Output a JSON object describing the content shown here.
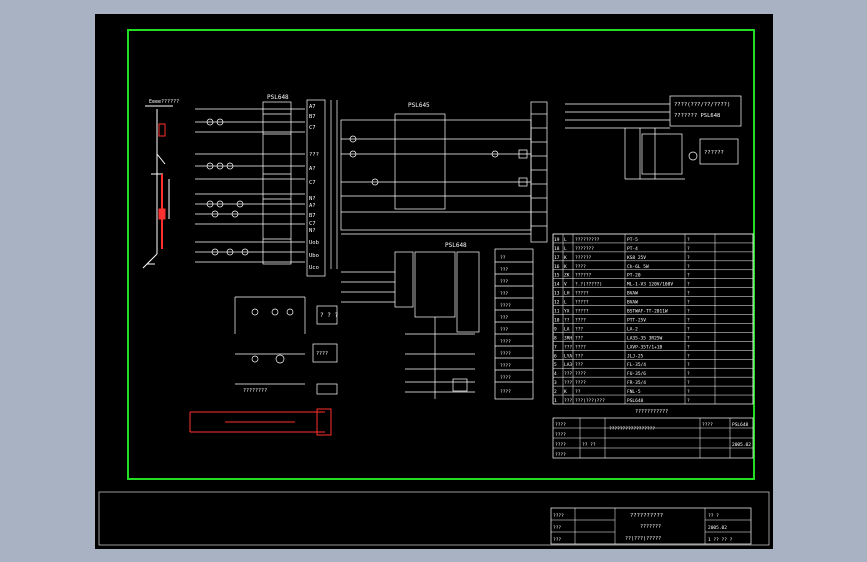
{
  "colors": {
    "background": "#a9b2c3",
    "sheet": "#000000",
    "frame": "#22dd22",
    "line": "#ffffff",
    "accent": "#ff3030"
  },
  "device_top": "PSL648",
  "device_mid": "PSL645",
  "device_lower": "PSL648",
  "top_right_box_1": "????(???/??/????)",
  "top_right_box_2": "??????? PSL648",
  "top_right_box_3": "??????",
  "left_terminals": [
    "A7",
    "B7",
    "C7",
    "???",
    "A?",
    "C7",
    "N?",
    "A?",
    "B7",
    "C7",
    "N?",
    "Uob",
    "Ubo",
    "Uco"
  ],
  "mid_box_label": "? ? ?",
  "mid_box_label2": "????",
  "meter_label": "????????",
  "lower_legend": [
    "??",
    "???",
    "???",
    "???",
    "????",
    "???",
    "???",
    "????",
    "????",
    "????",
    "????",
    "????"
  ],
  "bom_title": "???????????",
  "bom_rows": [
    {
      "no": "19",
      "sym": "L",
      "name": "?????????",
      "spec": "PT-5",
      "qty": "?"
    },
    {
      "no": "18",
      "sym": "L",
      "name": "???????",
      "spec": "PT-4",
      "qty": "?"
    },
    {
      "no": "17",
      "sym": "K",
      "name": "??????",
      "spec": "KS8 25V",
      "qty": "?"
    },
    {
      "no": "16",
      "sym": "K",
      "name": "????",
      "spec": "Ch-6L 5W",
      "qty": "?"
    },
    {
      "no": "15",
      "sym": "ZK",
      "name": "??????",
      "spec": "PT-20",
      "qty": "?"
    },
    {
      "no": "14",
      "sym": "V",
      "name": "?.?(?????)",
      "spec": "ML-1-V3 120V/100V",
      "qty": "?"
    },
    {
      "no": "13",
      "sym": "LH",
      "name": "?????",
      "spec": "BVAW",
      "qty": "?"
    },
    {
      "no": "12",
      "sym": "L",
      "name": "?????",
      "spec": "BVAW",
      "qty": "?"
    },
    {
      "no": "11",
      "sym": "YX",
      "name": "?????",
      "spec": "BSTWAF-TT-2011W",
      "qty": "?"
    },
    {
      "no": "10",
      "sym": "??",
      "name": "????",
      "spec": "PTT-25V",
      "qty": "?"
    },
    {
      "no": "9",
      "sym": "LA",
      "name": "???",
      "spec": "LA-2",
      "qty": "?"
    },
    {
      "no": "8",
      "sym": "3RH",
      "name": "???",
      "spec": "LA35-35 3R25W",
      "qty": "?"
    },
    {
      "no": "7",
      "sym": "???",
      "name": "????",
      "spec": "LXVP-35T/1+1B",
      "qty": "?"
    },
    {
      "no": "6",
      "sym": "LYA",
      "name": "???",
      "spec": "JLJ-25",
      "qty": "?"
    },
    {
      "no": "5",
      "sym": "LA3",
      "name": "???",
      "spec": "FL-35/4",
      "qty": "?"
    },
    {
      "no": "4",
      "sym": "???",
      "name": "????",
      "spec": "FU-35/6",
      "qty": "?"
    },
    {
      "no": "3",
      "sym": "???",
      "name": "????",
      "spec": "FR-35/4",
      "qty": "?"
    },
    {
      "no": "2",
      "sym": "K",
      "name": "??",
      "spec": "FNL-5",
      "qty": "?"
    },
    {
      "no": "1",
      "sym": "???",
      "name": "???(???)???",
      "spec": "PSL648",
      "qty": "?"
    }
  ],
  "title_block_1": {
    "r1": "????",
    "r2": "????",
    "r3": "????",
    "r4": "????",
    "center": "?????????????????",
    "side": "????",
    "r5": "?? ??",
    "code": "PSL648",
    "date": "2005.02"
  },
  "title_block_2": {
    "r1": "????",
    "r2": "???",
    "r3": "???",
    "main": "??????????",
    "sub": "???????",
    "sub2": "??(???)?????",
    "right1": "?? ?",
    "right2": "2005.02",
    "right3": "1 ?? ?? ?"
  }
}
